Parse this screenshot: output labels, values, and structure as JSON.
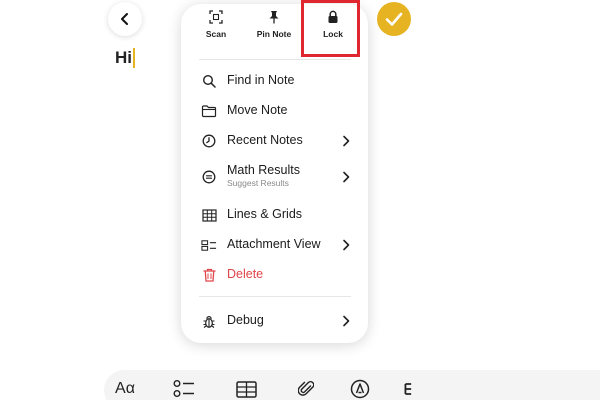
{
  "note": {
    "text": "Hi"
  },
  "menu": {
    "top_actions": [
      {
        "label": "Scan",
        "icon": "scan-icon"
      },
      {
        "label": "Pin Note",
        "icon": "pin-icon"
      },
      {
        "label": "Lock",
        "icon": "lock-icon"
      }
    ],
    "items": [
      {
        "label": "Find in Note",
        "icon": "search-icon"
      },
      {
        "label": "Move Note",
        "icon": "folder-icon"
      },
      {
        "label": "Recent Notes",
        "icon": "clock-icon",
        "has_submenu": true
      },
      {
        "label": "Math Results",
        "sublabel": "Suggest Results",
        "icon": "math-icon",
        "has_submenu": true
      },
      {
        "label": "Lines & Grids",
        "icon": "grid-icon"
      },
      {
        "label": "Attachment View",
        "icon": "attachment-view-icon",
        "has_submenu": true
      },
      {
        "label": "Delete",
        "icon": "trash-icon",
        "destructive": true
      },
      {
        "label": "Debug",
        "icon": "bug-icon",
        "has_submenu": true
      }
    ]
  },
  "toolbar": {
    "format_label": "Aα",
    "items": [
      "format-icon",
      "checklist-icon",
      "table-icon",
      "paperclip-icon",
      "markup-icon"
    ]
  },
  "colors": {
    "accent": "#e6b422",
    "destructive": "#e0454a",
    "highlight": "#e0262f"
  }
}
